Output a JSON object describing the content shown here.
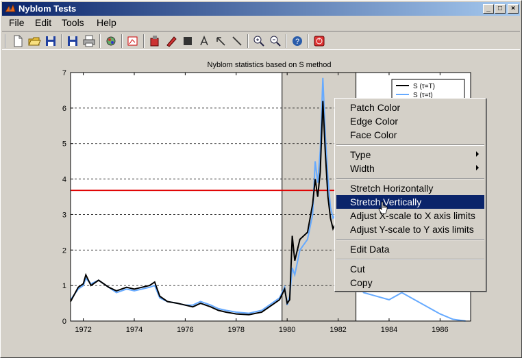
{
  "window": {
    "title": "Nyblom Tests"
  },
  "titlebar_buttons": {
    "minimize": "_",
    "maximize": "□",
    "close": "×"
  },
  "menubar": {
    "items": [
      "File",
      "Edit",
      "Tools",
      "Help"
    ]
  },
  "toolbar": {
    "icons": [
      "new-file-icon",
      "open-folder-icon",
      "save-icon",
      "save-as-icon",
      "print-icon",
      "export-icon",
      "figure-icon",
      "plot-editor-icon",
      "insert-icon",
      "rectangle-icon",
      "text-icon",
      "arrow-icon",
      "line-icon",
      "zoom-in-icon",
      "zoom-out-icon",
      "help-icon",
      "stop-icon"
    ]
  },
  "colors": {
    "selection": "#0a246a",
    "series_T": "#000000",
    "series_t": "#66aaff",
    "critical_line": "#e00000"
  },
  "context_menu": {
    "groups": [
      [
        "Patch Color",
        "Edge Color",
        "Face Color"
      ],
      [
        "Type",
        "Width"
      ],
      [
        "Stretch Horizontally",
        "Stretch Vertically",
        "Adjust X-scale to X axis limits",
        "Adjust Y-scale to Y axis limits"
      ],
      [
        "Edit Data"
      ],
      [
        "Cut",
        "Copy"
      ]
    ],
    "submenu_items": [
      "Type",
      "Width"
    ],
    "selected": "Stretch Vertically"
  },
  "chart_data": {
    "type": "line",
    "title": "Nyblom statistics based on S method",
    "xlim": [
      1971.5,
      1987.2
    ],
    "ylim": [
      0,
      7
    ],
    "xticks": [
      1972,
      1974,
      1976,
      1978,
      1980,
      1982,
      1984,
      1986
    ],
    "yticks": [
      0,
      1,
      2,
      3,
      4,
      5,
      6,
      7
    ],
    "grid": "dashed horizontal",
    "legend": "top-right",
    "critical_value": 3.68,
    "shaded_region": [
      1979.8,
      1982.7
    ],
    "series": [
      {
        "name": "S (τ=T)",
        "color": "#000000",
        "x": [
          1971.5,
          1971.8,
          1972.0,
          1972.1,
          1972.3,
          1972.6,
          1973.0,
          1973.3,
          1973.7,
          1974.0,
          1974.3,
          1974.6,
          1974.8,
          1975.0,
          1975.3,
          1975.7,
          1976.0,
          1976.3,
          1976.6,
          1977.0,
          1977.3,
          1977.6,
          1978.0,
          1978.5,
          1979.0,
          1979.3,
          1979.7,
          1979.9,
          1980.0,
          1980.1,
          1980.2,
          1980.3,
          1980.5,
          1980.8,
          1981.0,
          1981.1,
          1981.2,
          1981.3,
          1981.4,
          1981.5,
          1981.6,
          1981.7,
          1981.8,
          1982.0,
          1982.3,
          1982.7
        ],
        "y": [
          0.55,
          0.95,
          1.05,
          1.3,
          1.0,
          1.15,
          0.95,
          0.85,
          0.95,
          0.9,
          0.95,
          1.0,
          1.1,
          0.7,
          0.55,
          0.5,
          0.45,
          0.4,
          0.5,
          0.4,
          0.3,
          0.25,
          0.2,
          0.18,
          0.25,
          0.4,
          0.6,
          0.9,
          0.5,
          0.6,
          2.4,
          1.7,
          2.3,
          2.5,
          3.3,
          4.0,
          3.5,
          4.2,
          6.2,
          4.7,
          3.5,
          2.9,
          2.6,
          2.9,
          2.4,
          2.1
        ]
      },
      {
        "name": "S (τ=t)",
        "color": "#66aaff",
        "x": [
          1971.5,
          1971.8,
          1972.0,
          1972.1,
          1972.3,
          1972.6,
          1973.0,
          1973.3,
          1973.7,
          1974.0,
          1974.3,
          1974.6,
          1974.8,
          1975.0,
          1975.3,
          1975.7,
          1976.0,
          1976.3,
          1976.6,
          1977.0,
          1977.3,
          1977.6,
          1978.0,
          1978.5,
          1979.0,
          1979.3,
          1979.7,
          1979.9,
          1980.0,
          1980.1,
          1980.2,
          1980.3,
          1980.5,
          1980.8,
          1981.0,
          1981.1,
          1981.2,
          1981.3,
          1981.4,
          1981.5,
          1981.6,
          1981.7,
          1981.8,
          1982.0,
          1982.3,
          1982.7,
          1983.0,
          1983.5,
          1984.0,
          1984.5,
          1985.0,
          1985.5,
          1986.0,
          1986.5,
          1987.0
        ],
        "y": [
          0.6,
          0.9,
          1.0,
          1.2,
          1.05,
          1.15,
          0.95,
          0.8,
          0.9,
          0.85,
          0.9,
          0.95,
          1.0,
          0.65,
          0.55,
          0.5,
          0.45,
          0.45,
          0.55,
          0.45,
          0.35,
          0.3,
          0.25,
          0.22,
          0.3,
          0.45,
          0.65,
          0.95,
          0.45,
          0.7,
          1.5,
          1.3,
          2.0,
          2.3,
          3.0,
          4.5,
          3.9,
          4.8,
          6.85,
          5.2,
          4.0,
          3.2,
          2.9,
          3.1,
          2.7,
          1.1,
          0.8,
          0.7,
          0.6,
          0.8,
          0.6,
          0.4,
          0.2,
          0.05,
          0.0
        ]
      }
    ]
  }
}
